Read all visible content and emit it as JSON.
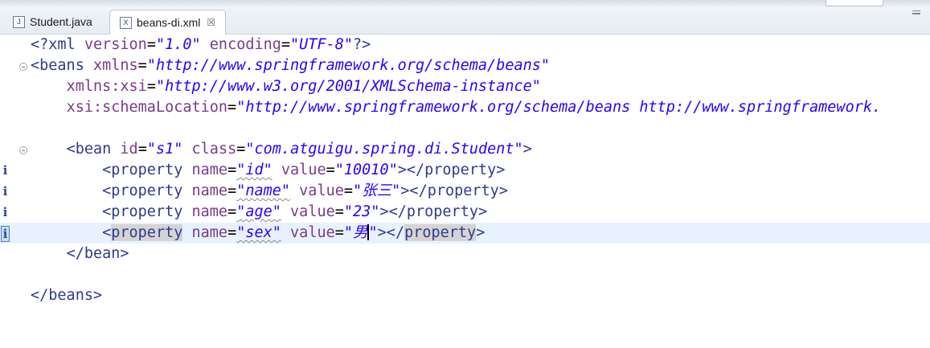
{
  "tabs": [
    {
      "label": "Student.java",
      "icon": "java-file-icon",
      "active": false
    },
    {
      "label": "beans-di.xml",
      "icon": "xml-file-icon",
      "active": true,
      "close": "☒"
    }
  ],
  "editor": {
    "lines": [
      {
        "text": "<?xml version=\"1.0\" encoding=\"UTF-8\"?>"
      },
      {
        "text": "<beans xmlns=\"http://www.springframework.org/schema/beans\""
      },
      {
        "text": "    xmlns:xsi=\"http://www.w3.org/2001/XMLSchema-instance\""
      },
      {
        "text": "    xsi:schemaLocation=\"http://www.springframework.org/schema/beans http://www.springframework."
      },
      {
        "text": ""
      },
      {
        "text": "    <bean id=\"s1\" class=\"com.atguigu.spring.di.Student\">"
      },
      {
        "text": "        <property name=\"id\" value=\"10010\"></property>"
      },
      {
        "text": "        <property name=\"name\" value=\"张三\"></property>"
      },
      {
        "text": "        <property name=\"age\" value=\"23\"></property>"
      },
      {
        "text": "        <property name=\"sex\" value=\"男\"></property>"
      },
      {
        "text": "    </bean>"
      },
      {
        "text": ""
      },
      {
        "text": "</beans>"
      }
    ],
    "markers": [
      "i",
      "i",
      "i",
      "i"
    ]
  },
  "colors": {
    "tag": "#2f3a8f",
    "attribute": "#7b3a8c",
    "value": "#2a00ff",
    "current_line": "#e8f2fe"
  }
}
